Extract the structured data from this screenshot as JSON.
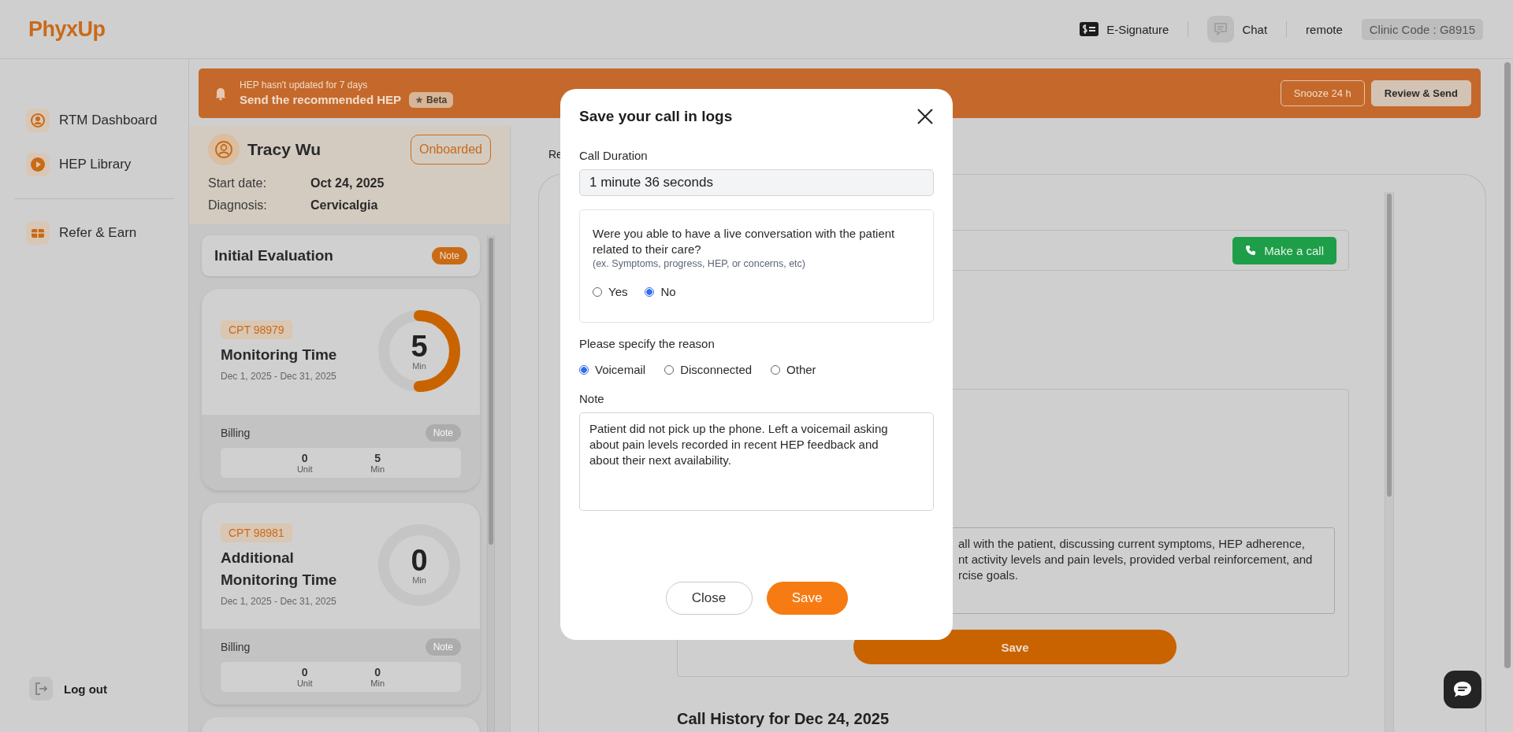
{
  "header": {
    "logo": "PhyxUp",
    "actions": [
      {
        "kind": "signature",
        "label": "E-Signature"
      },
      {
        "kind": "chat",
        "label": "Chat"
      }
    ],
    "user": "remote",
    "clinic_code": "Clinic Code : G8915"
  },
  "sidebar": {
    "sections": [
      {
        "items": [
          {
            "kind": "user",
            "label": "RTM Dashboard"
          },
          {
            "kind": "play",
            "label": "HEP Library"
          }
        ]
      },
      {
        "items": [
          {
            "kind": "gift",
            "label": "Refer & Earn"
          }
        ]
      }
    ],
    "logout": "Log out"
  },
  "banner": {
    "notice": "HEP hasn't updated for 7 days",
    "title": "Send the recommended HEP",
    "badge": "Beta",
    "buttons": [
      {
        "label": "Snooze 24 h",
        "kind": "outline"
      },
      {
        "label": "Review & Send",
        "kind": "filled"
      }
    ]
  },
  "patient": {
    "name": "Tracy Wu",
    "status": "Onboarded",
    "fields": [
      {
        "label": "Start date:",
        "value": "Oct 24, 2025"
      },
      {
        "label": "Diagnosis:",
        "value": "Cervicalgia"
      }
    ]
  },
  "evaluation": {
    "title": "Initial Evaluation",
    "note": "Note"
  },
  "cpt_cards": [
    {
      "code": "CPT 98979",
      "title": "Monitoring Time",
      "dates": "Dec 1, 2025 - Dec 31, 2025",
      "minutes": "5",
      "unit": "Min",
      "level": 0.5,
      "billing": {
        "label": "Billing",
        "note": "Note",
        "disabled": true,
        "stats": [
          {
            "value": "0",
            "unit": "Unit"
          },
          {
            "value": "5",
            "unit": "Min"
          }
        ]
      }
    },
    {
      "code": "CPT 98981",
      "title": "Additional Monitoring Time",
      "dates": "Dec 1, 2025 - Dec 31, 2025",
      "minutes": "0",
      "unit": "Min",
      "level": 0,
      "billing": {
        "label": "Billing",
        "note": "Note",
        "disabled": true,
        "stats": [
          {
            "value": "0",
            "unit": "Unit"
          },
          {
            "value": "0",
            "unit": "Min"
          }
        ]
      }
    }
  ],
  "main": {
    "tab": "Re",
    "call_button": "Make a call",
    "note_lines": [
      "all with the patient, discussing current symptoms, HEP adherence,",
      "nt activity levels and pain levels, provided verbal reinforcement, and",
      "rcise goals."
    ],
    "save": "Save",
    "history_title": "Call History for Dec 24, 2025"
  },
  "modal": {
    "title": "Save your call in logs",
    "duration_label": "Call Duration",
    "duration": "1 minute 36 seconds",
    "question": "Were you able to have a live conversation with the patient related to their care?",
    "hint": "(ex. Symptoms, progress, HEP, or concerns, etc)",
    "answers": [
      {
        "label": "Yes",
        "selected": false
      },
      {
        "label": "No",
        "selected": true
      }
    ],
    "reason_label": "Please specify the reason",
    "reasons": [
      {
        "label": "Voicemail",
        "selected": true
      },
      {
        "label": "Disconnected",
        "selected": false
      },
      {
        "label": "Other",
        "selected": false
      }
    ],
    "note_label": "Note",
    "note": "Patient did not pick up the phone. Left a voicemail asking about pain levels recorded in recent HEP feedback and about their next availability.",
    "buttons": [
      {
        "label": "Close",
        "kind": "secondary"
      },
      {
        "label": "Save",
        "kind": "primary"
      }
    ]
  }
}
